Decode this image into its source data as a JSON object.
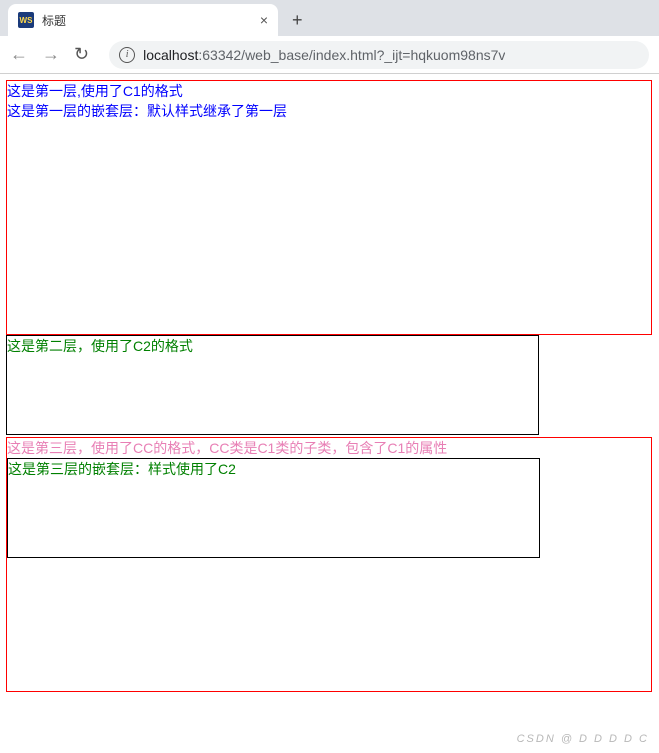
{
  "tab": {
    "favicon": "WS",
    "title": "标题"
  },
  "url": {
    "host": "localhost",
    "rest": ":63342/web_base/index.html?_ijt=hqkuom98ns7v"
  },
  "layer1": {
    "text": "这是第一层,使用了C1的格式",
    "nested": "这是第一层的嵌套层：默认样式继承了第一层"
  },
  "layer2": {
    "text": "这是第二层，使用了C2的格式"
  },
  "layer3": {
    "text": "这是第三层，使用了CC的格式，CC类是C1类的子类，包含了C1的属性",
    "nested": "这是第三层的嵌套层：样式使用了C2"
  },
  "watermark": "CSDN @ D D D D C"
}
